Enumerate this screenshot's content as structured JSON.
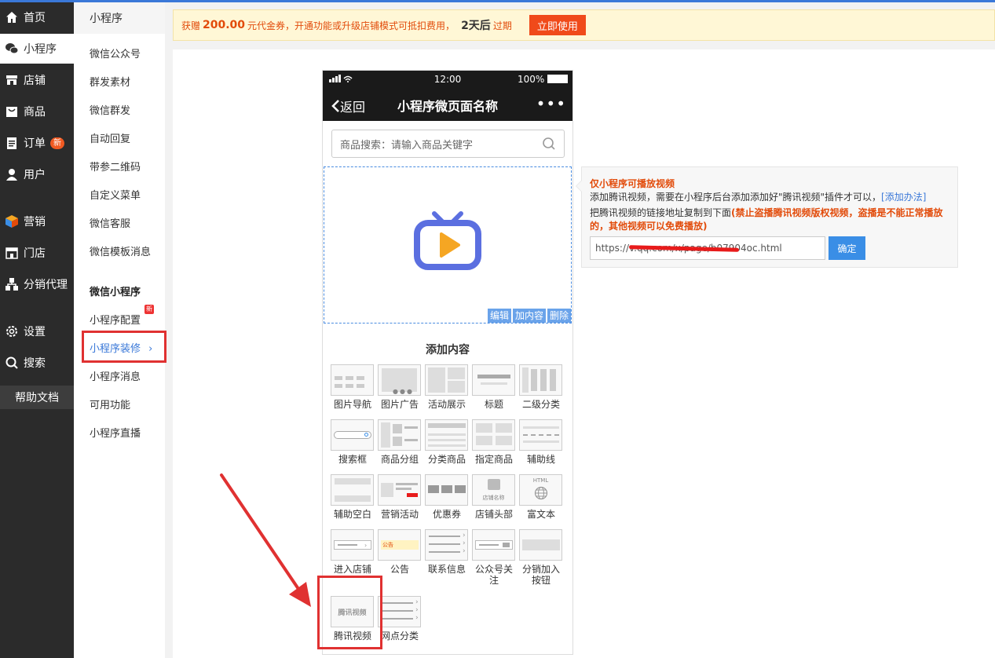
{
  "sidebar": {
    "items": [
      {
        "label": "首页",
        "icon": "home-icon"
      },
      {
        "label": "小程序",
        "icon": "wechat-icon"
      },
      {
        "label": "店铺",
        "icon": "store-icon"
      },
      {
        "label": "商品",
        "icon": "goods-icon"
      },
      {
        "label": "订单",
        "icon": "order-icon",
        "badge": "新"
      },
      {
        "label": "用户",
        "icon": "user-icon"
      },
      {
        "label": "营销",
        "icon": "marketing-icon"
      },
      {
        "label": "门店",
        "icon": "shop-icon"
      },
      {
        "label": "分销代理",
        "icon": "distribution-icon"
      },
      {
        "label": "设置",
        "icon": "gear-icon"
      },
      {
        "label": "搜索",
        "icon": "search-icon"
      }
    ],
    "help": "帮助文档"
  },
  "subnav": {
    "header": "小程序",
    "group1": [
      "微信公众号",
      "群发素材",
      "微信群发",
      "自动回复",
      "带参二维码",
      "自定义菜单",
      "微信客服",
      "微信模板消息"
    ],
    "section": "微信小程序",
    "group2": [
      "小程序配置",
      "小程序装修",
      "小程序消息",
      "可用功能",
      "小程序直播"
    ],
    "new_mark": "新",
    "active_arrow": "›"
  },
  "notice": {
    "prefix": "获赠",
    "amount": "200.00",
    "text": "元代金券，开通功能或升级店铺模式可抵扣费用，",
    "days": "2天后",
    "suffix": "过期",
    "button": "立即使用"
  },
  "phone": {
    "time": "12:00",
    "battery": "100%",
    "back": "返回",
    "title": "小程序微页面名称",
    "more": "•••",
    "search_placeholder": "商品搜索：请输入商品关键字",
    "actions": [
      "编辑",
      "加内容",
      "删除"
    ],
    "add_title": "添加内容"
  },
  "widgets": [
    {
      "label": "图片导航"
    },
    {
      "label": "图片广告"
    },
    {
      "label": "活动展示"
    },
    {
      "label": "标题"
    },
    {
      "label": "二级分类"
    },
    {
      "label": "搜索框"
    },
    {
      "label": "商品分组"
    },
    {
      "label": "分类商品"
    },
    {
      "label": "指定商品"
    },
    {
      "label": "辅助线"
    },
    {
      "label": "辅助空白"
    },
    {
      "label": "营销活动"
    },
    {
      "label": "优惠券"
    },
    {
      "label": "店铺头部"
    },
    {
      "label": "富文本"
    },
    {
      "label": "进入店铺"
    },
    {
      "label": "公告"
    },
    {
      "label": "联系信息"
    },
    {
      "label": "公众号关注"
    },
    {
      "label": "分销加入按钮"
    },
    {
      "label": "腾讯视频"
    },
    {
      "label": "网点分类"
    }
  ],
  "widget_text": {
    "store_name": "店铺名称",
    "html": "HTML",
    "notice_tag": "公告",
    "tencent_video": "腾讯视频"
  },
  "video_panel": {
    "title": "仅小程序可播放视频",
    "line2": "添加腾讯视频，需要在小程序后台添加添加好\"腾讯视频\"插件才可以，",
    "link": "[添加办法]",
    "line3": "把腾讯视频的链接地址复制到下面",
    "warning": "(禁止盗播腾讯视频版权视频，盗播是不能正常播放的，其他视频可以免费播放)",
    "url_value": "https://v.qq.com/x/page/b07904oc.html",
    "confirm": "确定"
  },
  "colors": {
    "accent": "#3a78d8",
    "warning": "#e24b0a",
    "annotation": "#e03131",
    "video_icon_frame": "#5b6fe0",
    "video_icon_play": "#f5a623"
  }
}
